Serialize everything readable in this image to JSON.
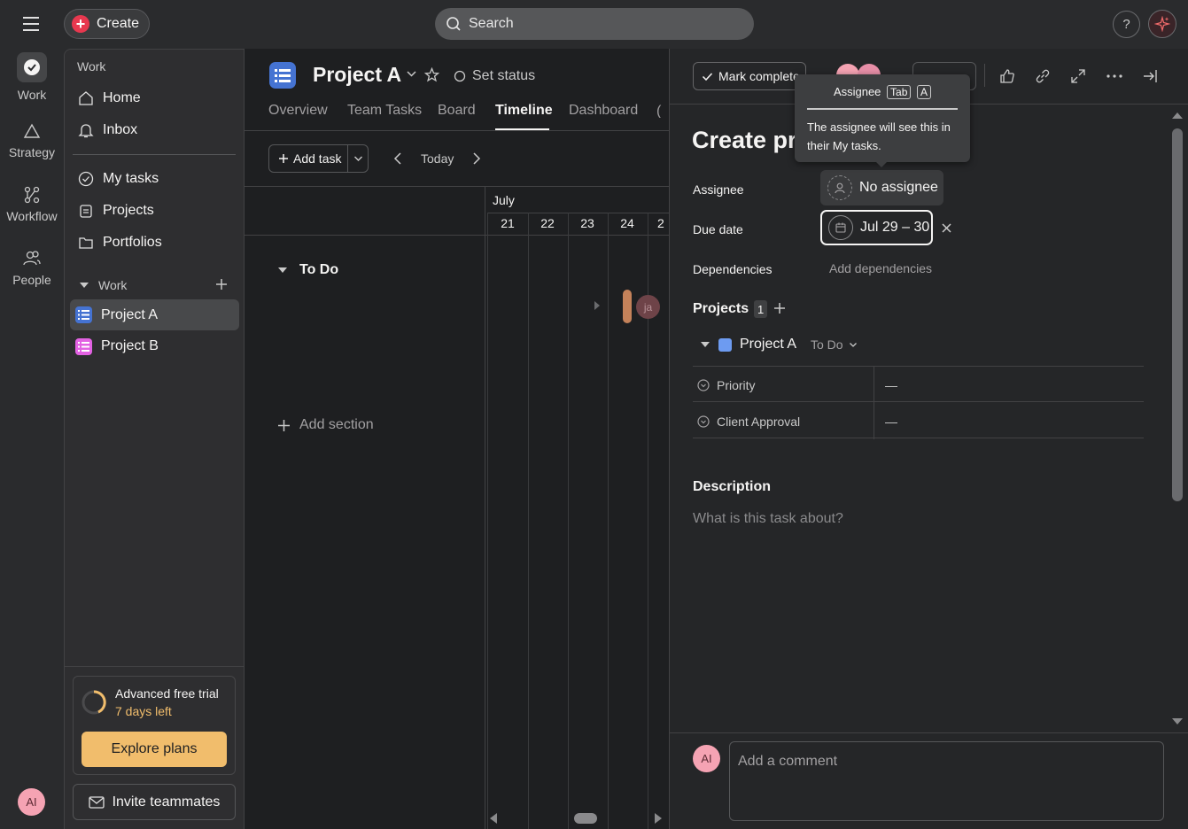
{
  "topbar": {
    "create_label": "Create",
    "search_placeholder": "Search",
    "help_label": "?"
  },
  "rail": {
    "items": [
      {
        "label": "Work",
        "icon": "check-circle-icon"
      },
      {
        "label": "Strategy",
        "icon": "triangle-icon"
      },
      {
        "label": "Workflow",
        "icon": "workflow-icon"
      },
      {
        "label": "People",
        "icon": "people-icon"
      }
    ],
    "avatar": "AI"
  },
  "sidebar": {
    "section_title": "Work",
    "nav": [
      {
        "label": "Home",
        "icon": "home-icon"
      },
      {
        "label": "Inbox",
        "icon": "bell-icon"
      },
      {
        "label": "My tasks",
        "icon": "check-circle-icon"
      },
      {
        "label": "Projects",
        "icon": "clipboard-icon"
      },
      {
        "label": "Portfolios",
        "icon": "folder-icon"
      }
    ],
    "group_title": "Work",
    "projects": [
      {
        "label": "Project A",
        "color": "#4573d2"
      },
      {
        "label": "Project B",
        "color": "#e362e3"
      }
    ],
    "trial_title": "Advanced free trial",
    "trial_days": "7 days left",
    "explore_label": "Explore plans",
    "invite_label": "Invite teammates"
  },
  "project": {
    "title": "Project A",
    "set_status": "Set status",
    "tabs": [
      "Overview",
      "Team Tasks",
      "Board",
      "Timeline",
      "Dashboard"
    ],
    "active_tab": "Timeline",
    "add_task": "Add task",
    "today": "Today",
    "month": "July",
    "days": [
      "21",
      "22",
      "23",
      "24",
      "2"
    ],
    "section": "To Do",
    "add_section": "Add section",
    "bar_avatar": "ja"
  },
  "task": {
    "mark_complete": "Mark complete",
    "title": "Create pr",
    "assignee_label": "Assignee",
    "assignee_value": "No assignee",
    "due_label": "Due date",
    "due_value": "Jul 29 – 30",
    "dependencies_label": "Dependencies",
    "dependencies_value": "Add dependencies",
    "projects_label": "Projects",
    "projects_count": "1",
    "project_name": "Project A",
    "project_section": "To Do",
    "fields": [
      {
        "label": "Priority",
        "value": "—"
      },
      {
        "label": "Client Approval",
        "value": "—"
      }
    ],
    "description_label": "Description",
    "description_placeholder": "What is this task about?",
    "comment_placeholder": "Add a comment",
    "comment_avatar": "AI"
  },
  "tooltip": {
    "title": "Assignee",
    "key1": "Tab",
    "key2": "A",
    "body": "The assignee will see this in their My tasks."
  },
  "colors": {
    "accent_create": "#e8384f",
    "explore_button": "#f1bd6c",
    "project_a": "#4573d2",
    "project_b": "#e362e3"
  }
}
